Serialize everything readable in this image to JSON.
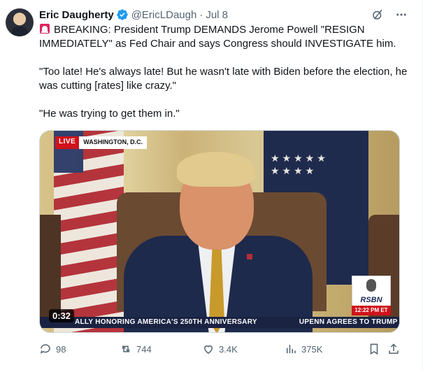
{
  "author": {
    "name": "Eric Daugherty",
    "handle": "@EricLDaugh",
    "separator": "·",
    "date": "Jul 8",
    "verified_color": "#1d9bf0"
  },
  "icons": {
    "grok": "grok-icon",
    "more": "more-dots-icon",
    "siren": "rotating-light-emoji",
    "reply": "reply-icon",
    "repost": "repost-icon",
    "like": "heart-icon",
    "views": "views-icon",
    "bookmark": "bookmark-icon",
    "share": "share-icon"
  },
  "tweet": {
    "line1": "BREAKING: President Trump DEMANDS Jerome Powell \"RESIGN IMMEDIATELY\" as Fed Chair and says Congress should INVESTIGATE him.",
    "line2": "\"Too late! He's always late! But he wasn't late with Biden before the election, he was cutting [rates] like crazy.\"",
    "line3": "\"He was trying to get them in.\""
  },
  "video": {
    "live_label": "LIVE",
    "location": "WASHINGTON, D.C.",
    "logo_text": "RSBN",
    "logo_time": "12:22 PM ET",
    "ticker_1": "ALLY HONORING AMERICA'S 250TH ANNIVERSARY",
    "ticker_2": "UPENN AGREES TO TRUMP ADMIN'S T",
    "duration": "0:32"
  },
  "actions": {
    "replies": "98",
    "reposts": "744",
    "likes": "3.4K",
    "views": "375K"
  },
  "colors": {
    "text": "#0f1419",
    "secondary": "#536471",
    "accent": "#1d9bf0"
  }
}
